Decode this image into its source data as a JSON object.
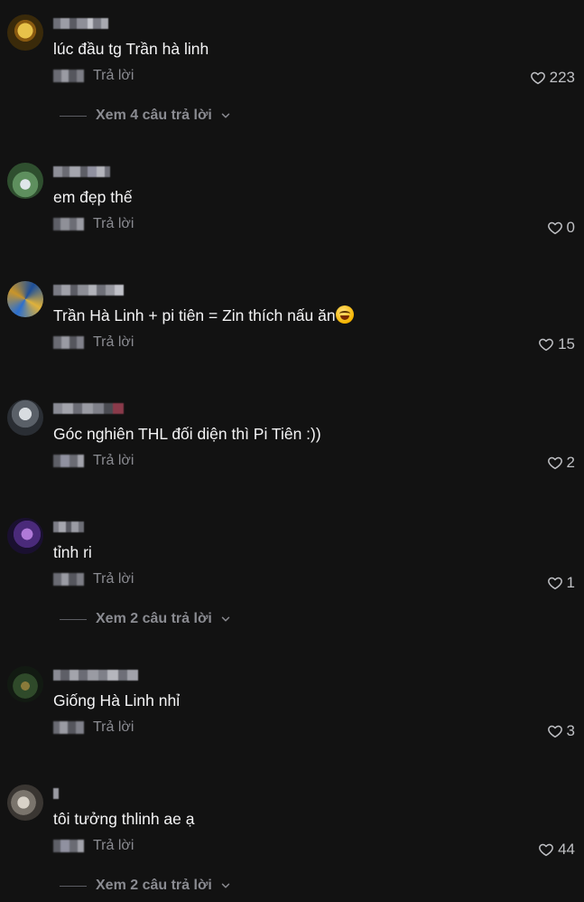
{
  "ui": {
    "reply_label": "Trả lời",
    "heart_icon": "heart-outline-icon",
    "chevron_icon": "chevron-down-icon",
    "colors": {
      "background": "#121212",
      "text_primary": "#f4f4f5",
      "text_secondary": "#8a8b91"
    }
  },
  "comments": [
    {
      "text": "lúc đầu tg Trần hà linh",
      "likes": "223",
      "view_replies": "Xem 4 câu trả lời"
    },
    {
      "text": "em đẹp thế",
      "likes": "0"
    },
    {
      "text": "Trần Hà Linh + pi tiên = Zin thích nấu ăn",
      "emoji": "smiling-sweat-emoji",
      "likes": "15"
    },
    {
      "text": "Góc nghiên THL đối diện thì Pi Tiên :))",
      "likes": "2"
    },
    {
      "text": "tỉnh ri",
      "likes": "1",
      "view_replies": "Xem 2 câu trả lời"
    },
    {
      "text": "Giống Hà Linh nhỉ",
      "likes": "3"
    },
    {
      "text": "tôi tưởng thlinh ae ạ",
      "likes": "44",
      "view_replies": "Xem 2 câu trả lời"
    }
  ]
}
